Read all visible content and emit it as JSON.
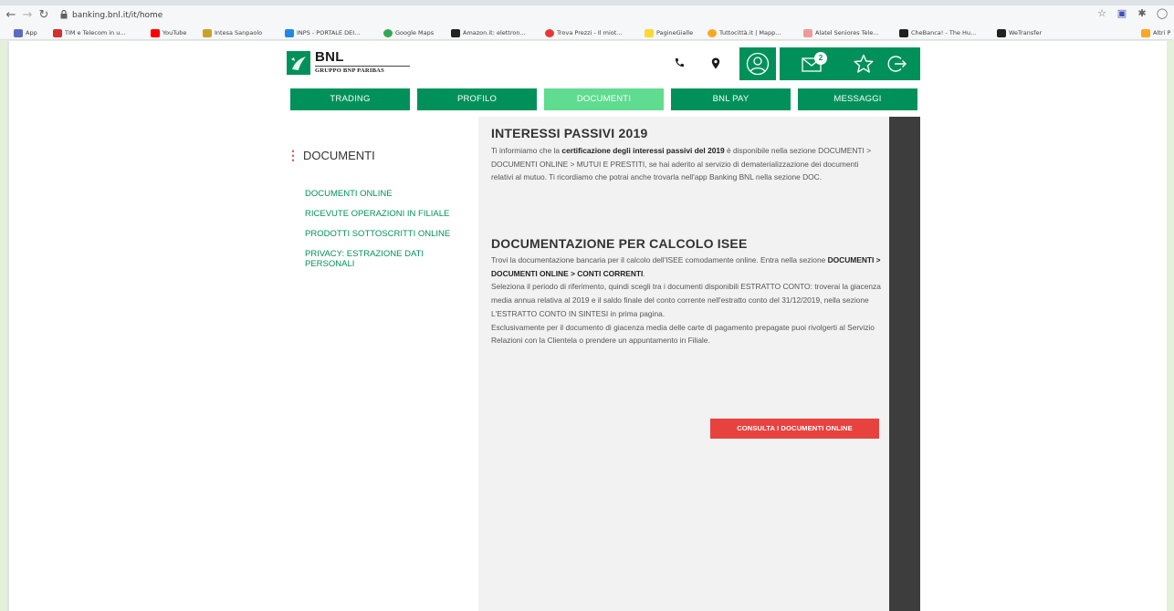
{
  "browser": {
    "url": "banking.bnl.it/it/home",
    "bookmarks": [
      {
        "label": "App",
        "color": "#5c6bc0"
      },
      {
        "label": "TIM e Telecom in u...",
        "color": "#d32f2f"
      },
      {
        "label": "YouTube",
        "color": "#ff0000"
      },
      {
        "label": "Intesa Sanpaolo",
        "color": "#c9a227"
      },
      {
        "label": "INPS - PORTALE DEI...",
        "color": "#1e88e5"
      },
      {
        "label": "Google Maps",
        "color": "#34a853"
      },
      {
        "label": "Amazon.it: elettron...",
        "color": "#222222"
      },
      {
        "label": "Trova Prezzi - Il miot...",
        "color": "#e53935"
      },
      {
        "label": "PagineGialle",
        "color": "#fdd835"
      },
      {
        "label": "Tuttocittà.it | Mapp...",
        "color": "#f9a825"
      },
      {
        "label": "Alatel Seniores Tele...",
        "color": "#ef9a9a"
      },
      {
        "label": "CheBanca! - The Hu...",
        "color": "#212121"
      },
      {
        "label": "WeTransfer",
        "color": "#212121"
      },
      {
        "label": "Altri P",
        "color": "#f9a825"
      }
    ]
  },
  "brand": {
    "name": "BNL",
    "subtitle": "GRUPPO BNP PARIBAS",
    "mail_count": "2",
    "green": "#00915a",
    "active_tab": "#5fdc8f",
    "cta_red": "#e8423f"
  },
  "tabs": [
    "TRADING",
    "PROFILO",
    "DOCUMENTI",
    "BNL PAY",
    "MESSAGGI"
  ],
  "sidebar": {
    "title": "DOCUMENTI",
    "links": [
      "DOCUMENTI ONLINE",
      "RICEVUTE OPERAZIONI IN FILIALE",
      "PRODOTTI SOTTOSCRITTI ONLINE",
      "PRIVACY: ESTRAZIONE DATI PERSONALI"
    ]
  },
  "section1": {
    "title": "INTERESSI PASSIVI 2019",
    "text_a": "Ti informiamo che la ",
    "text_b": "certificazione degli interessi passivi del 2019",
    "text_c": " è disponibile nella sezione DOCUMENTI > DOCUMENTI ONLINE > MUTUI E PRESTITI, se hai aderito al servizio di dematerializzazione dei documenti relativi al mutuo. Ti ricordiamo che potrai anche trovarla nell'app Banking BNL nella sezione DOC."
  },
  "section2": {
    "title": "DOCUMENTAZIONE PER CALCOLO ISEE",
    "text_a": "Trovi la documentazione bancaria per il calcolo dell'ISEE comodamente online. Entra nella sezione ",
    "text_b": "DOCUMENTI > DOCUMENTI ONLINE > CONTI CORRENTI",
    "text_c": ".",
    "text_d": "Seleziona il periodo di riferimento, quindi scegli tra i documenti disponibili ESTRATTO CONTO: troverai la giacenza media annua relativa al 2019 e il saldo finale del conto corrente nell'estratto conto del 31/12/2019, nella sezione L'ESTRATTO CONTO IN SINTESI in prima pagina.",
    "text_e": "Esclusivamente per il documento di giacenza media delle carte di pagamento prepagate puoi rivolgerti al Servizio Relazioni con la Clientela o prendere un appuntamento in Filiale.",
    "button": "CONSULTA I DOCUMENTI ONLINE"
  }
}
